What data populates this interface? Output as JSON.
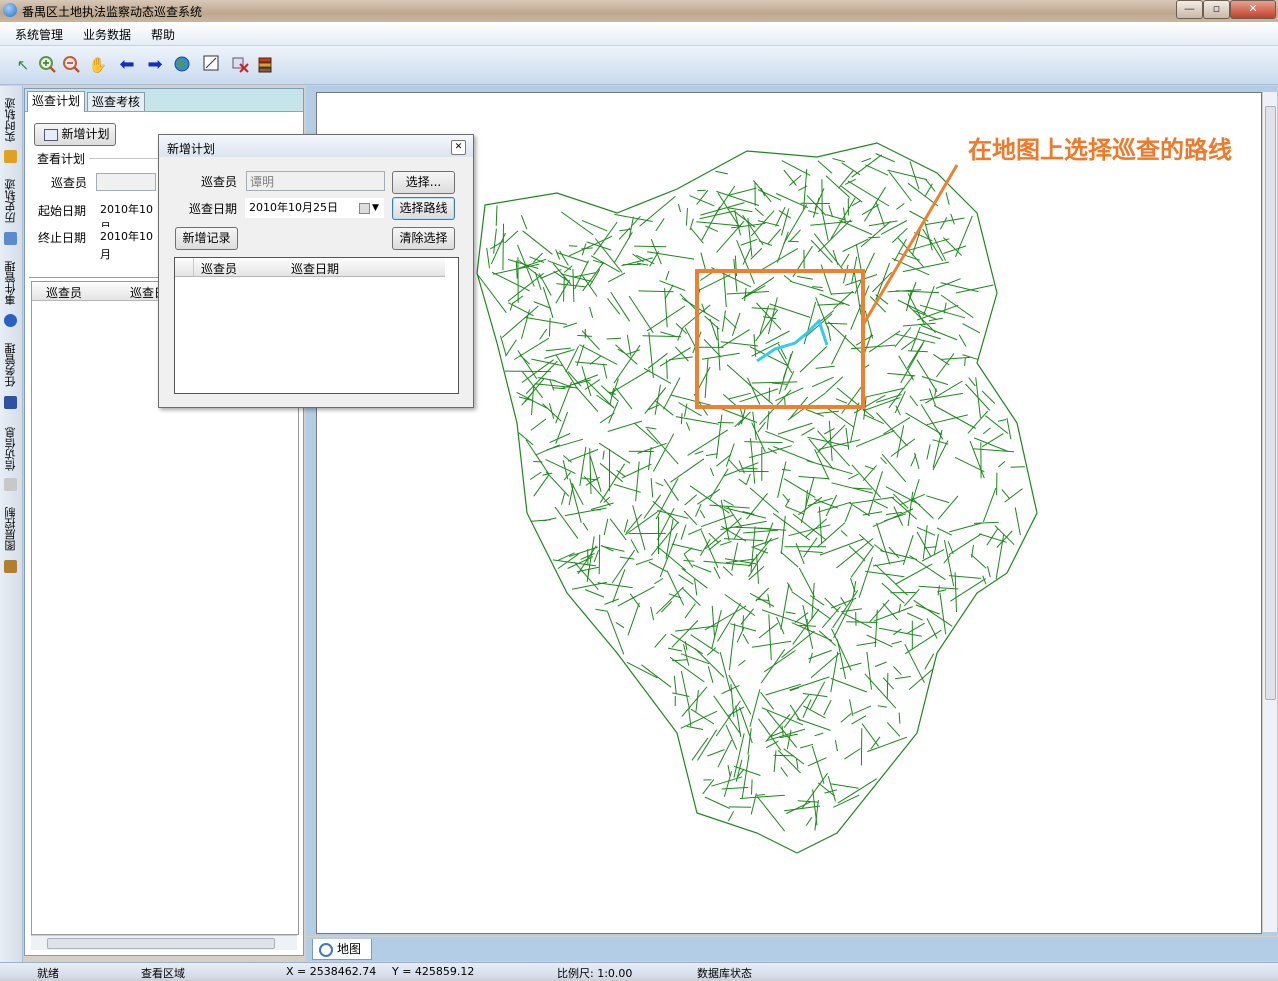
{
  "window": {
    "title": "番禺区土地执法监察动态巡查系统",
    "minimize_glyph": "—",
    "maximize_glyph": "▫",
    "close_glyph": "✕"
  },
  "menu": {
    "items": [
      "系统管理",
      "业务数据",
      "帮助"
    ]
  },
  "toolbar": {
    "icons": [
      "select-arrow-icon",
      "zoom-in-icon",
      "zoom-out-icon",
      "pan-hand-icon",
      "back-arrow-icon",
      "forward-arrow-icon",
      "globe-icon",
      "full-extent-icon",
      "clear-select-icon",
      "layers-icon"
    ]
  },
  "side_tabs": {
    "items": [
      "实时轨迹",
      "历史轨迹",
      "事件管理",
      "任务管理",
      "信访信息",
      "图层控制"
    ]
  },
  "left_panel": {
    "tabs": [
      "巡查计划",
      "巡查考核"
    ],
    "new_plan_button": "新增计划",
    "group_title": "查看计划",
    "inspector_label": "巡查员",
    "start_date_label": "起始日期",
    "start_date_value": "2010年10月",
    "end_date_label": "终止日期",
    "end_date_value": "2010年10月",
    "grid_headers": [
      "巡查员",
      "巡查日"
    ]
  },
  "dialog": {
    "title": "新增计划",
    "inspector_label": "巡查员",
    "inspector_value": "谭明",
    "select_button": "选择...",
    "date_label": "巡查日期",
    "date_value": "2010年10月25日",
    "select_route_button": "选择路线",
    "add_record_button": "新增记录",
    "clear_button": "清除选择",
    "grid_headers": [
      "巡查员",
      "巡查日期"
    ]
  },
  "map": {
    "annotation": "在地图上选择巡查的路线",
    "road_color": "#1a8a1a",
    "route_color": "#33ccee",
    "highlight_color": "#f08030",
    "tab_label": "地图"
  },
  "status": {
    "ready": "就绪",
    "area": "查看区域",
    "x": "X = 2538462.74",
    "y": "Y = 425859.12",
    "scale": "比例尺: 1:0.00",
    "db": "数据库状态"
  }
}
